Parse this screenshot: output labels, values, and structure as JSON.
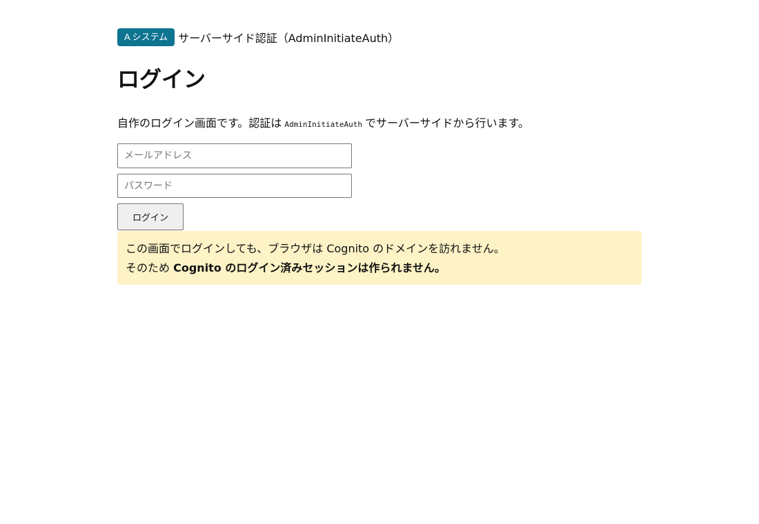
{
  "header": {
    "badge": "A システム",
    "title": "サーバーサイド認証（AdminInitiateAuth）"
  },
  "page_title": "ログイン",
  "description": {
    "before": "自作のログイン画面です。認証は",
    "code": "AdminInitiateAuth",
    "after": "でサーバーサイドから行います。"
  },
  "form": {
    "email_placeholder": "メールアドレス",
    "email_value": "",
    "password_placeholder": "パスワード",
    "password_value": "",
    "login_button": "ログイン"
  },
  "notice": {
    "line1": "この画面でログインしても、ブラウザは Cognito のドメインを訪れません。",
    "line2_prefix": "そのため",
    "line2_bold": "Cognito のログイン済みセッションは作られません。"
  },
  "colors": {
    "badge_bg": "#0e7490",
    "notice_bg": "#fef3c7"
  }
}
